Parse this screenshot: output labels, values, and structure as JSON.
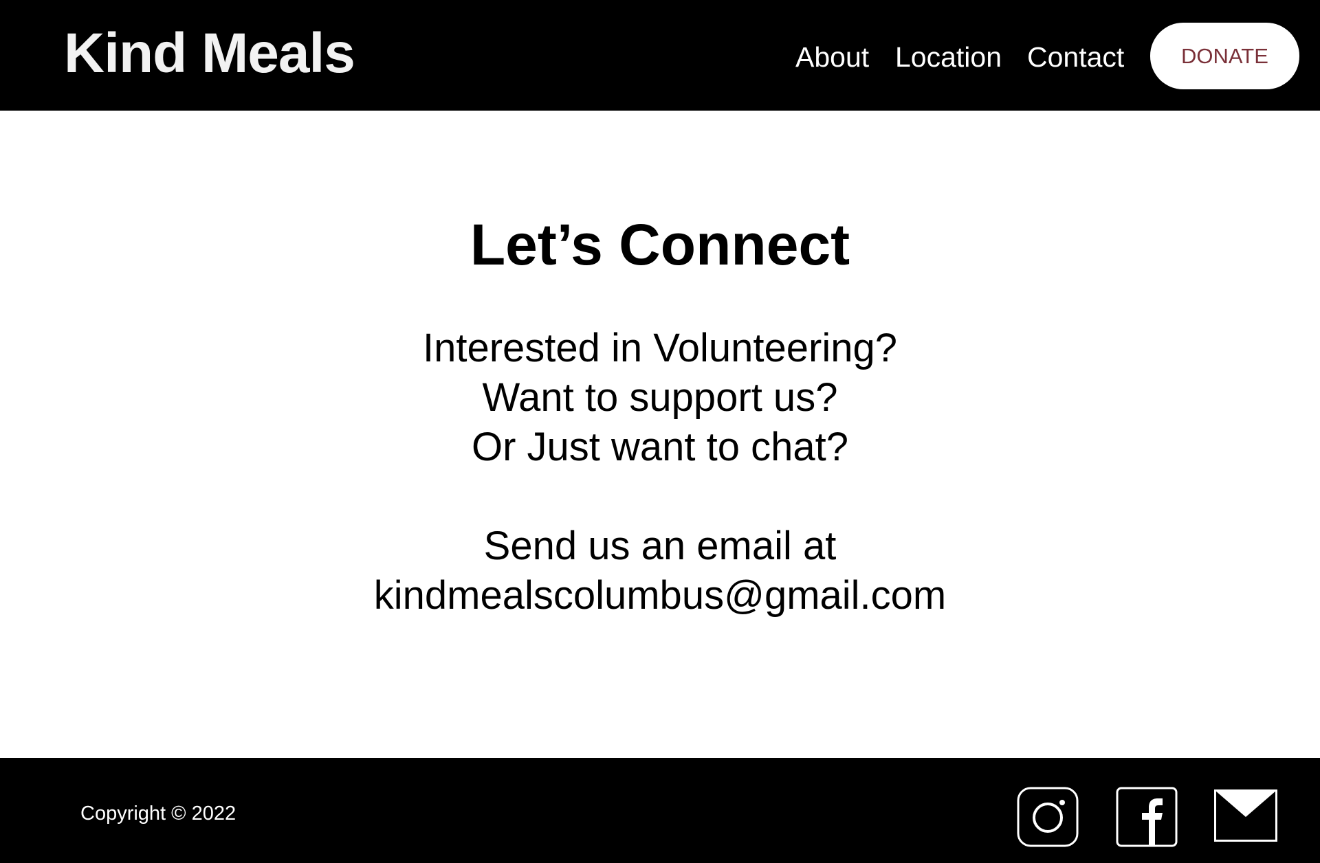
{
  "header": {
    "brand": "Kind Meals",
    "nav": {
      "about": "About",
      "location": "Location",
      "contact": "Contact"
    },
    "donate_label": "DONATE"
  },
  "main": {
    "title": "Let’s Connect",
    "line1": "Interested in Volunteering?",
    "line2": "Want to support us?",
    "line3": "Or Just want to chat?",
    "line4": "Send us an email at",
    "email": "kindmealscolumbus@gmail.com"
  },
  "footer": {
    "copyright": "Copyright © 2022",
    "icons": [
      "instagram-icon",
      "facebook-icon",
      "email-icon"
    ]
  },
  "colors": {
    "header_bg": "#000000",
    "footer_bg": "#000000",
    "donate_text": "#7a3038",
    "brand_text": "#f2f2f2"
  }
}
